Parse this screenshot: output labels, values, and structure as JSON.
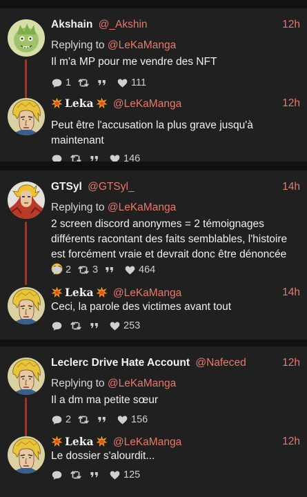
{
  "colors": {
    "accent": "#e9786c",
    "background": "#202020",
    "separator": "#111111"
  },
  "threads": [
    {
      "tweets": [
        {
          "avatar": "green-monster-avatar",
          "name": "Akshain",
          "handle": "@_Akshin",
          "time": "12h",
          "replying_prefix": "Replying to",
          "replying_handle": "@LeKaManga",
          "text": "Il m'a MP pour me vendre des NFT",
          "reply_count": "1",
          "retweet_count": "",
          "like_count": "111"
        },
        {
          "avatar": "blonde-character-avatar",
          "name": "Leka",
          "handle": "@LeKaManga",
          "time": "12h",
          "text": "Peut être l'accusation la plus grave jusqu'à maintenant",
          "reply_count": "",
          "retweet_count": "",
          "like_count": "146"
        }
      ]
    },
    {
      "tweets": [
        {
          "avatar": "anime-fighter-avatar",
          "name": "GTSyl",
          "handle": "@GTSyl_",
          "time": "14h",
          "replying_prefix": "Replying to",
          "replying_handle": "@LeKaManga",
          "text": "2 screen discord anonymes = 2 témoignages différents racontant des faits semblables, l'histoire est forcément vraie et devrait donc être dénoncée",
          "emoji": "face-with-monocle",
          "reply_count": "2",
          "retweet_count": "3",
          "like_count": "464"
        },
        {
          "avatar": "blonde-character-avatar",
          "name": "Leka",
          "handle": "@LeKaManga",
          "time": "14h",
          "text": "Ceci, la parole des victimes avant tout",
          "reply_count": "",
          "retweet_count": "",
          "like_count": "253"
        }
      ]
    },
    {
      "tweets": [
        {
          "avatar": "blonde-character-avatar",
          "name": "Leclerc Drive Hate Account",
          "handle": "@Nafeced",
          "time": "12h",
          "replying_prefix": "Replying to",
          "replying_handle": "@LeKaManga",
          "text": "Il a dm ma petite sœur",
          "reply_count": "2",
          "retweet_count": "",
          "like_count": "156"
        },
        {
          "avatar": "blonde-character-avatar",
          "name": "Leka",
          "handle": "@LeKaManga",
          "time": "12h",
          "text": "Le dossier s'alourdit...",
          "reply_count": "",
          "retweet_count": "",
          "like_count": "125"
        }
      ]
    }
  ]
}
